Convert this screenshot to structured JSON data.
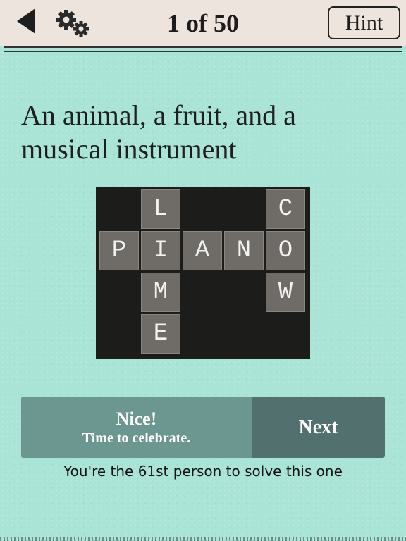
{
  "header": {
    "title": "1 of 50",
    "hint_label": "Hint"
  },
  "puzzle": {
    "question": "An animal, a fruit, and a musical instrument",
    "tiles": [
      {
        "letter": "L",
        "row": 0,
        "col": 1
      },
      {
        "letter": "C",
        "row": 0,
        "col": 4
      },
      {
        "letter": "P",
        "row": 1,
        "col": 0
      },
      {
        "letter": "I",
        "row": 1,
        "col": 1
      },
      {
        "letter": "A",
        "row": 1,
        "col": 2
      },
      {
        "letter": "N",
        "row": 1,
        "col": 3
      },
      {
        "letter": "O",
        "row": 1,
        "col": 4
      },
      {
        "letter": "M",
        "row": 2,
        "col": 1
      },
      {
        "letter": "W",
        "row": 2,
        "col": 4
      },
      {
        "letter": "E",
        "row": 3,
        "col": 1
      }
    ]
  },
  "result": {
    "headline": "Nice!",
    "subline": "Time to celebrate.",
    "next_label": "Next",
    "solver_note": "You're the 61st person to solve this one"
  },
  "colors": {
    "background": "#a9e4d6",
    "board": "#1c1c1a",
    "tile": "#6f6b67",
    "result_left": "#6c9690",
    "next_button": "#52716e"
  },
  "icons": {
    "back": "back-arrow-icon",
    "settings": "gear-icon"
  }
}
